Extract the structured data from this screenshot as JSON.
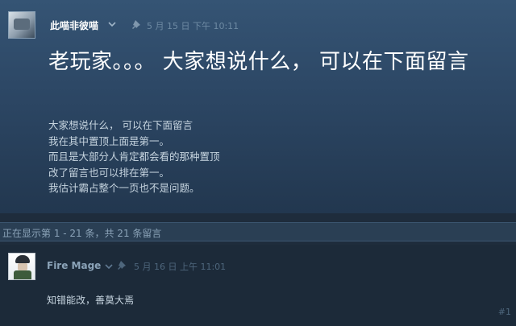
{
  "post": {
    "author": "此喵非彼喵",
    "timestamp": "5 月 15 日 下午 10:11",
    "title": "老玩家。。。 大家想说什么， 可以在下面留言",
    "body": [
      "大家想说什么， 可以在下面留言",
      "我在其中置顶上面是第一。",
      "而且是大部分人肯定都会看的那种置顶",
      "改了留言也可以排在第一。",
      "我估计霸占整个一页也不是问题。"
    ]
  },
  "pager": {
    "text": "正在显示第 1 - 21 条，共 21 条留言"
  },
  "comment": {
    "author": "Fire Mage",
    "timestamp": "5 月 16 日 上午 11:01",
    "text": "知错能改，善莫大焉",
    "number": "#1"
  },
  "icons": {
    "author_menu": "chevron-down-icon",
    "pin": "pin-icon"
  }
}
